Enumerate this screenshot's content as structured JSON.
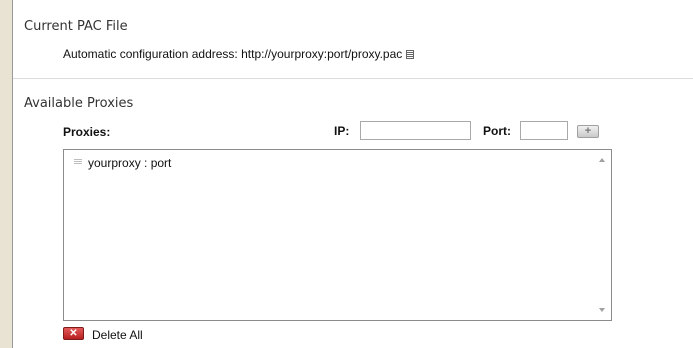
{
  "current_pac": {
    "title": "Current PAC File",
    "label": "Automatic configuration address: http://yourproxy:port/proxy.pac",
    "copy_icon": "copy-icon"
  },
  "available_proxies": {
    "title": "Available Proxies",
    "proxies_label": "Proxies:",
    "ip_label": "IP:",
    "ip_value": "",
    "port_label": "Port:",
    "port_value": "",
    "add_icon": "add-icon",
    "items": [
      {
        "label": "yourproxy : port"
      }
    ],
    "delete_all_label": "Delete All",
    "delete_icon": "delete-icon"
  },
  "colors": {
    "page_background": "#e9e3d4",
    "panel_background": "#ffffff",
    "delete_red": "#c62828"
  }
}
